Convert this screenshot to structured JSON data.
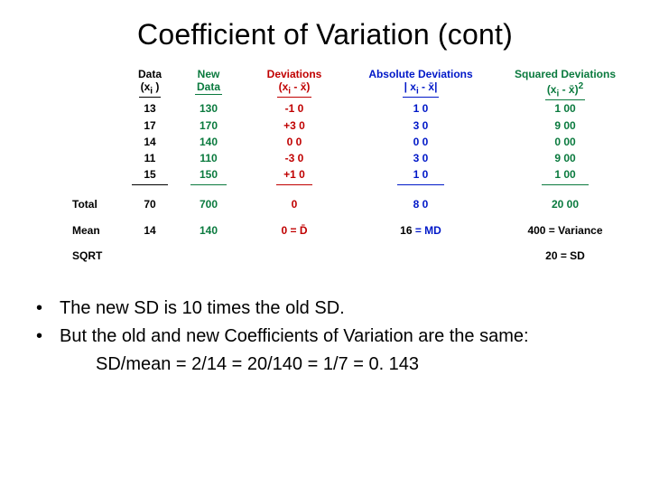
{
  "title": "Coefficient of Variation (cont)",
  "headers": {
    "data": {
      "l1": "Data",
      "l2_pre": "(x",
      "l2_sub": "i",
      "l2_post": " )"
    },
    "new": {
      "l1": "New",
      "l2": "Data"
    },
    "dev": {
      "l1": "Deviations",
      "l2_pre": "(x",
      "l2_sub": "i",
      "l2_mid": " - x̄",
      "l2_post": ")"
    },
    "abs": {
      "l1": "Absolute Deviations",
      "l2_pre": "| x",
      "l2_sub": "i",
      "l2_mid": " - x̄",
      "l2_post": "|"
    },
    "sq": {
      "l1": "Squared Deviations",
      "l2_pre": "(x",
      "l2_sub": "i",
      "l2_mid": " - x̄",
      "l2_post": ")",
      "l2_sup": "2"
    }
  },
  "rowLabels": {
    "total": "Total",
    "mean": "Mean",
    "sqrt": "SQRT"
  },
  "rows": [
    {
      "data": "13",
      "new": "130",
      "dev": "-1 0",
      "abs": "1 0",
      "sq": "1 00"
    },
    {
      "data": "17",
      "new": "170",
      "dev": "+3 0",
      "abs": "3 0",
      "sq": "9 00"
    },
    {
      "data": "14",
      "new": "140",
      "dev": "0 0",
      "abs": "0 0",
      "sq": "0 00"
    },
    {
      "data": "11",
      "new": "110",
      "dev": "-3 0",
      "abs": "3 0",
      "sq": "9 00"
    },
    {
      "data": "15",
      "new": "150",
      "dev": "+1 0",
      "abs": "1 0",
      "sq": "1 00"
    }
  ],
  "totals": {
    "data": "70",
    "new": "700",
    "dev": "0",
    "abs": "8 0",
    "sq": "20 00"
  },
  "means": {
    "data": "14",
    "new": "140",
    "dev": "0  = D̄",
    "abs_val": "16 ",
    "abs_eq": "= MD",
    "sq": "400 = Variance"
  },
  "sqrt": {
    "sq": "20 = SD"
  },
  "bullets": {
    "b1": "The new SD is 10 times the old SD.",
    "b2": "But the old and new Coefficients of Variation are the same:",
    "eq": "SD/mean = 2/14 = 20/140 = 1/7 = 0. 143"
  }
}
